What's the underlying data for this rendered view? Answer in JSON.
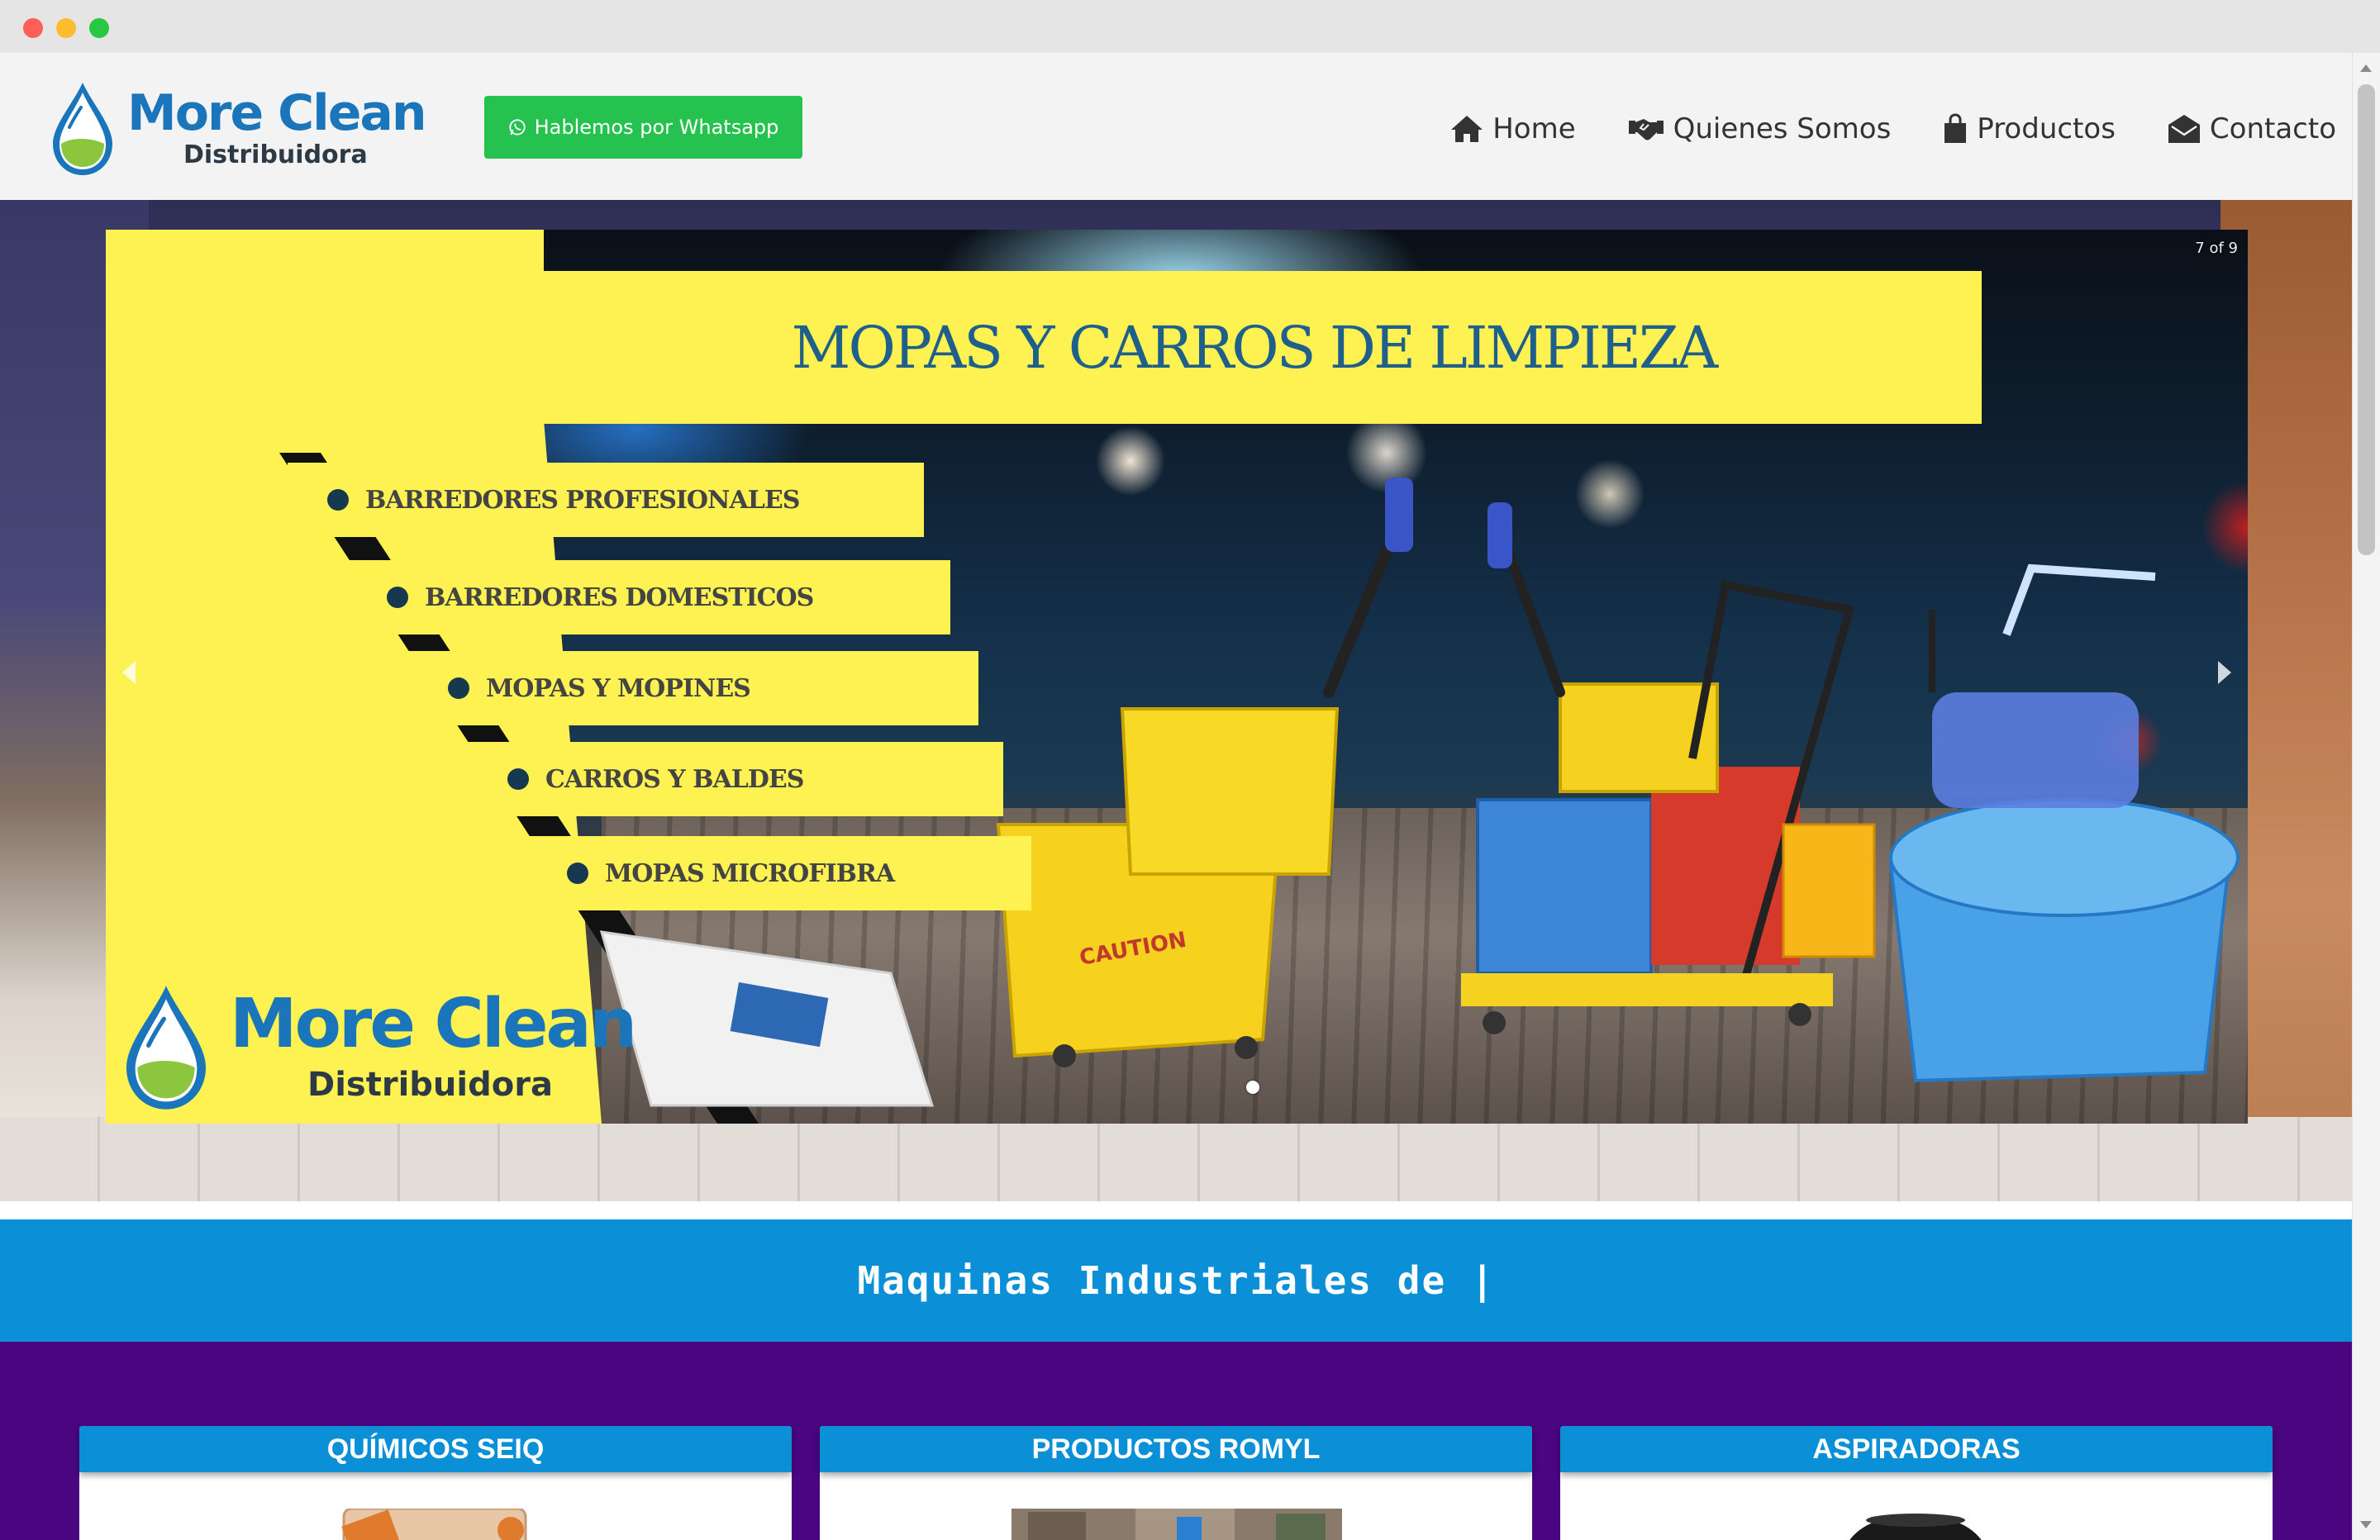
{
  "brand": {
    "name": "More Clean",
    "subtitle": "Distribuidora",
    "colors": {
      "primary": "#1b75bb",
      "green": "#25c24f",
      "band": "#0b90d8",
      "purple": "#4a0580",
      "slide_yellow": "#fdf251"
    }
  },
  "header": {
    "whatsapp_label": "Hablemos por Whatsapp",
    "nav": [
      {
        "label": "Home",
        "icon": "home-icon"
      },
      {
        "label": "Quienes Somos",
        "icon": "handshake-icon"
      },
      {
        "label": "Productos",
        "icon": "shopping-bag-icon"
      },
      {
        "label": "Contacto",
        "icon": "envelope-open-icon"
      }
    ]
  },
  "slider": {
    "counter": "7 of 9",
    "title": "MOPAS Y CARROS DE LIMPIEZA",
    "features": [
      "BARREDORES PROFESIONALES",
      "BARREDORES DOMESTICOS",
      "MOPAS Y MOPINES",
      "CARROS Y BALDES",
      "MOPAS MICROFIBRA"
    ],
    "logo_name": "More Clean",
    "logo_subtitle": "Distribuidora"
  },
  "tagline": "Maquinas Industriales de |",
  "categories": [
    {
      "label": "QUÍMICOS SEIQ"
    },
    {
      "label": "PRODUCTOS ROMYL"
    },
    {
      "label": "ASPIRADORAS"
    }
  ]
}
